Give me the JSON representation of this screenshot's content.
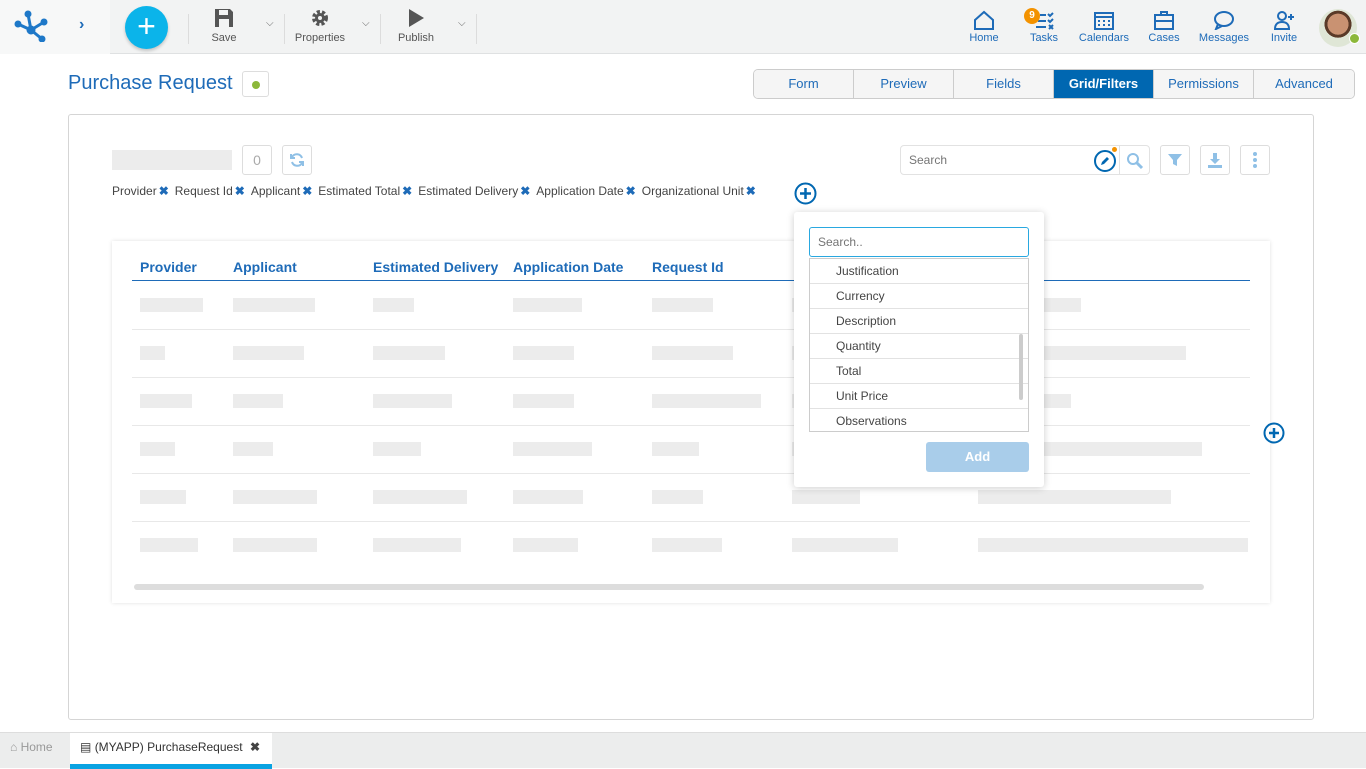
{
  "toolbar": {
    "save": "Save",
    "properties": "Properties",
    "publish": "Publish"
  },
  "nav": [
    {
      "label": "Home",
      "icon": "home-icon"
    },
    {
      "label": "Tasks",
      "icon": "tasks-icon",
      "badge": "9"
    },
    {
      "label": "Calendars",
      "icon": "calendar-icon"
    },
    {
      "label": "Cases",
      "icon": "briefcase-icon"
    },
    {
      "label": "Messages",
      "icon": "message-icon"
    },
    {
      "label": "Invite",
      "icon": "invite-icon"
    }
  ],
  "page": {
    "title": "Purchase Request",
    "status_color": "#8cb83a"
  },
  "tabs": [
    "Form",
    "Preview",
    "Fields",
    "Grid/Filters",
    "Permissions",
    "Advanced"
  ],
  "active_tab": "Grid/Filters",
  "grid_toolbar": {
    "count": "0",
    "search_placeholder": "Search"
  },
  "chips": [
    "Provider",
    "Request Id",
    "Applicant",
    "Estimated Total",
    "Estimated Delivery",
    "Application Date",
    "Organizational Unit"
  ],
  "columns": [
    "Provider",
    "Applicant",
    "Estimated Delivery",
    "Application Date",
    "Request Id"
  ],
  "popup": {
    "search_placeholder": "Search..",
    "items": [
      "Justification",
      "Currency",
      "Description",
      "Quantity",
      "Total",
      "Unit Price",
      "Observations"
    ],
    "add": "Add"
  },
  "bottom": {
    "home": "Home",
    "tab": "(MYAPP) PurchaseRequest"
  },
  "colors": {
    "accent": "#1e6bb8",
    "active_tab": "#0067b1",
    "fab": "#0bb4ea",
    "badge": "#f39200"
  }
}
